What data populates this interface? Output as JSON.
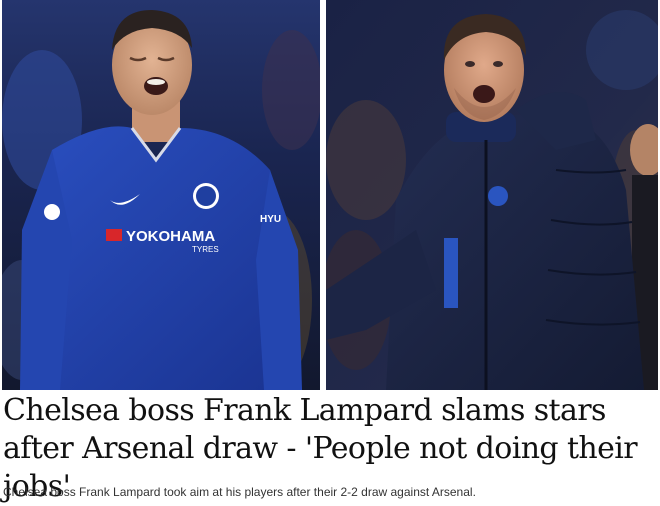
{
  "images": {
    "left": {
      "description_icon": "player-jersey-photo",
      "jersey_sponsor": "YOKOHAMA",
      "jersey_sponsor_sub": "TYRES"
    },
    "right": {
      "description_icon": "manager-coat-photo"
    }
  },
  "article": {
    "headline": "Chelsea boss Frank Lampard slams stars after Arsenal draw - 'People not doing their jobs'",
    "caption": "Chelsea boss Frank Lampard took aim at his players after their 2-2 draw against Arsenal."
  },
  "colors": {
    "jersey_blue": "#1f3fa0",
    "stadium_dark": "#1b2140",
    "coat_navy": "#1a2340",
    "headline_text": "#111111",
    "caption_text": "#333333"
  }
}
